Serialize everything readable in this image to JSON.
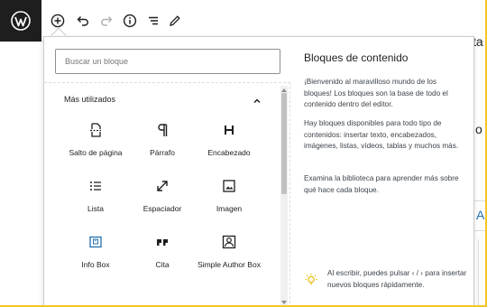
{
  "toolbar": {
    "logo": "wordpress-logo",
    "buttons": [
      "add-block",
      "undo",
      "redo",
      "details",
      "outline",
      "tools"
    ]
  },
  "background": {
    "right_chars": [
      "ta",
      "o",
      "A"
    ]
  },
  "search": {
    "placeholder": "Buscar un bloque"
  },
  "section": {
    "title": "Más utilizados"
  },
  "blocks": [
    {
      "label": "Salto de página",
      "icon": "page-break-icon"
    },
    {
      "label": "Párrafo",
      "icon": "paragraph-icon"
    },
    {
      "label": "Encabezado",
      "icon": "heading-icon"
    },
    {
      "label": "Lista",
      "icon": "list-icon"
    },
    {
      "label": "Espaciador",
      "icon": "spacer-icon"
    },
    {
      "label": "Imagen",
      "icon": "image-icon"
    },
    {
      "label": "Info Box",
      "icon": "info-box-icon"
    },
    {
      "label": "Cita",
      "icon": "quote-icon"
    },
    {
      "label": "Simple Author Box",
      "icon": "author-box-icon"
    }
  ],
  "help": {
    "title": "Bloques de contenido",
    "p1": "¡Bienvenido al maravilloso mundo de los bloques! Los bloques son la base de todo el contenido dentro del editor.",
    "p2": "Hay bloques disponibles para todo tipo de contenidos: insertar texto, encabezados, imágenes, listas, vídeos, tablas y muchos más.",
    "p3": "Examina la biblioteca para aprender más sobre qué hace cada bloque.",
    "tip": "Al escribir, puedes pulsar ‹ / › para insertar nuevos bloques rápidamente."
  },
  "colors": {
    "frame": "#f6c628",
    "logo_bg": "#1e1e1e",
    "accent_blue": "#2271b1"
  }
}
